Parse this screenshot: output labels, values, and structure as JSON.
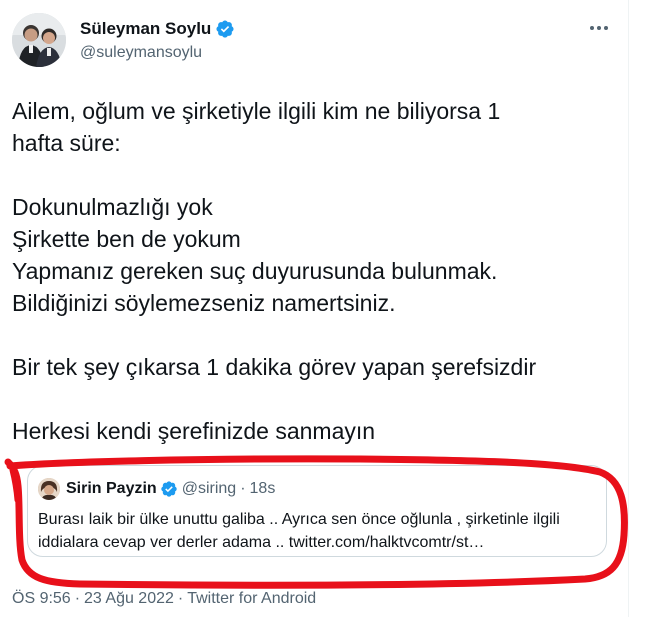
{
  "author": {
    "display_name": "Süleyman Soylu",
    "handle": "@suleymansoylu",
    "verified_color": "#1d9bf0"
  },
  "more_icon": "ellipsis-icon",
  "tweet": {
    "lines": [
      "Ailem, oğlum ve şirketiyle ilgili kim ne biliyorsa 1",
      "hafta süre:",
      "",
      "Dokunulmazlığı yok",
      "Şirkette ben de yokum",
      "Yapmanız gereken suç duyurusunda bulunmak.",
      "Bildiğinizi söylemezseniz namertsiniz.",
      "",
      "Bir tek şey çıkarsa 1 dakika görev yapan şerefsizdir",
      "",
      "Herkesi kendi şerefinizde sanmayın"
    ]
  },
  "quoted_tweet": {
    "display_name": "Sirin Payzin",
    "handle": "@siring",
    "dot": "·",
    "time": "18s",
    "text": "Burası laik bir ülke unuttu galiba .. Ayrıca sen önce oğlunla , şirketinle ilgili iddialara cevap ver derler adama .. twitter.com/halktvcomtr/st…"
  },
  "meta": {
    "time": "ÖS 9:56",
    "sep1": "·",
    "date": "23 Ağu 2022",
    "sep2": "·",
    "source": "Twitter for Android"
  },
  "annotation_color": "#e8101a"
}
